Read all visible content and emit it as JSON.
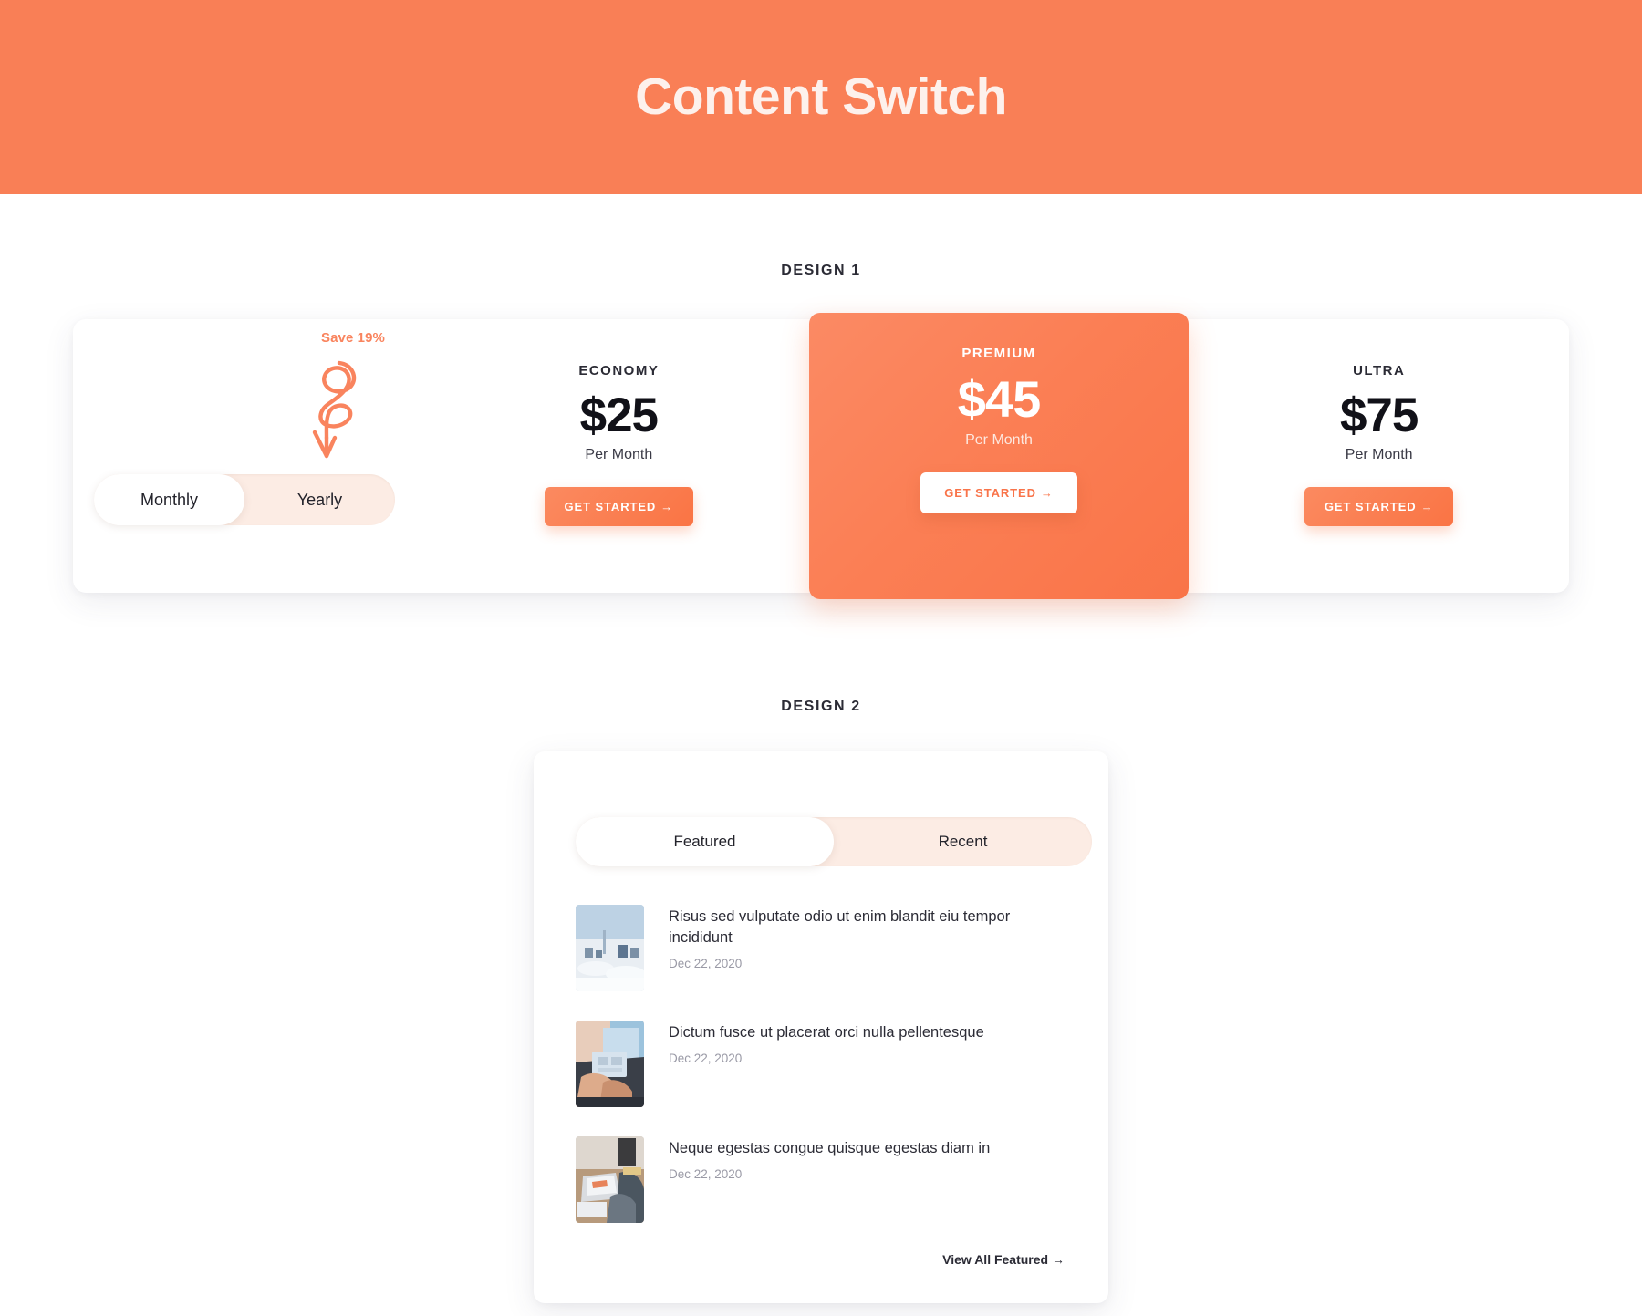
{
  "header": {
    "title": "Content Switch",
    "bg_color": "#F97F56",
    "title_color": "#FDF1EC"
  },
  "design1": {
    "label": "DESIGN 1",
    "switcher": {
      "save_badge": "Save 19%",
      "arrow_icon": "curly-arrow-icon",
      "options": [
        {
          "label": "Monthly",
          "active": true
        },
        {
          "label": "Yearly",
          "active": false
        }
      ],
      "track_color": "#FCECE4",
      "accent_color": "#F9845E"
    },
    "plans": [
      {
        "name": "ECONOMY",
        "price": "$25",
        "period": "Per Month",
        "cta": "GET STARTED",
        "cta_arrow": "→",
        "featured": false
      },
      {
        "name": "PREMIUM",
        "price": "$45",
        "period": "Per Month",
        "cta": "GET STARTED",
        "cta_arrow": "→",
        "featured": true
      },
      {
        "name": "ULTRA",
        "price": "$75",
        "period": "Per Month",
        "cta": "GET STARTED",
        "cta_arrow": "→",
        "featured": false
      }
    ]
  },
  "design2": {
    "label": "DESIGN 2",
    "tabs": [
      {
        "label": "Featured",
        "active": true
      },
      {
        "label": "Recent",
        "active": false
      }
    ],
    "articles": [
      {
        "title": "Risus sed vulputate odio ut enim blandit eiu tempor incididunt",
        "date": "Dec 22, 2020",
        "thumb": "snowy-city-photo"
      },
      {
        "title": "Dictum fusce ut placerat orci nulla pellentesque",
        "date": "Dec 22, 2020",
        "thumb": "person-at-laptop-photo"
      },
      {
        "title": "Neque egestas congue quisque egestas diam in",
        "date": "Dec 22, 2020",
        "thumb": "desk-workspace-photo"
      }
    ],
    "view_all": "View All Featured →"
  }
}
